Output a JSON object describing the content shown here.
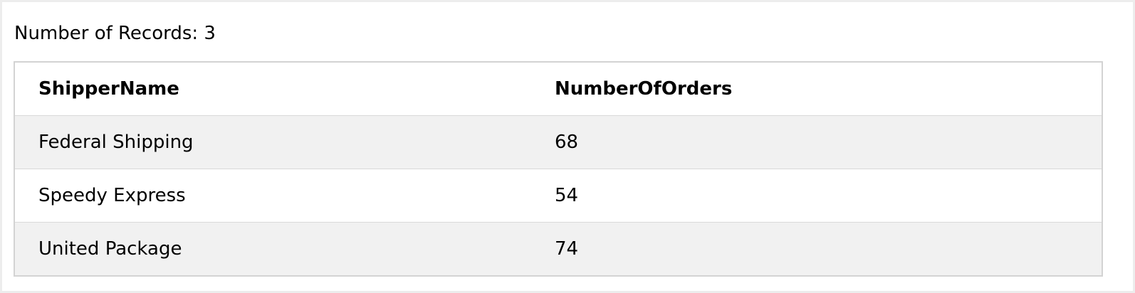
{
  "records": {
    "label": "Number of Records: 3"
  },
  "table": {
    "columns": [
      "ShipperName",
      "NumberOfOrders"
    ],
    "rows": [
      [
        "Federal Shipping",
        "68"
      ],
      [
        "Speedy Express",
        "54"
      ],
      [
        "United Package",
        "74"
      ]
    ]
  }
}
